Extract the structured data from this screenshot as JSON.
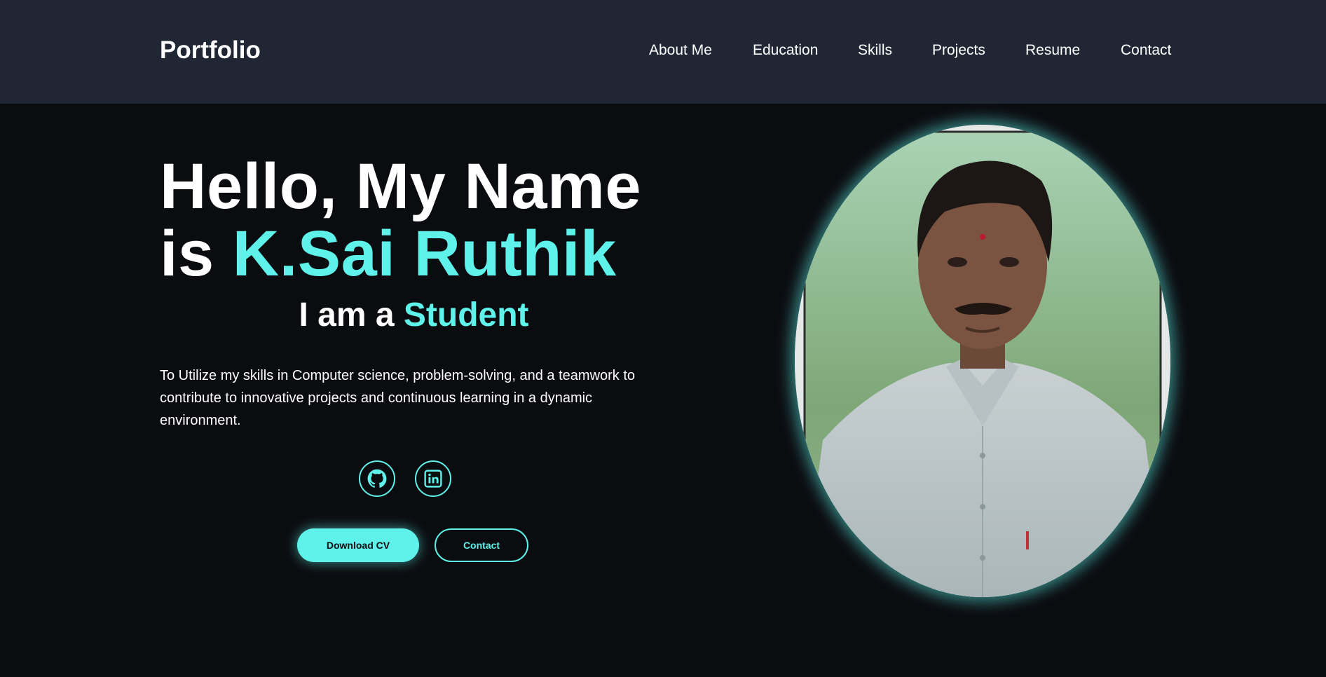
{
  "nav": {
    "brand": "Portfolio",
    "items": [
      {
        "label": "About Me"
      },
      {
        "label": "Education"
      },
      {
        "label": "Skills"
      },
      {
        "label": "Projects"
      },
      {
        "label": "Resume"
      },
      {
        "label": "Contact"
      }
    ]
  },
  "hero": {
    "greeting_line1": "Hello, My Name",
    "greeting_prefix": "is",
    "name": "K.Sai Ruthik",
    "subtitle_prefix": "I am a",
    "role": "Student",
    "summary": "To Utilize my skills in Computer science, problem-solving, and a teamwork to contribute to innovative projects and continuous learning in a dynamic environment.",
    "social": [
      {
        "icon": "github-icon"
      },
      {
        "icon": "linkedin-icon"
      }
    ],
    "buttons": {
      "download_cv": "Download CV",
      "contact": "Contact"
    }
  },
  "colors": {
    "accent": "#5ff2ea",
    "background": "#0b0c10",
    "navbar": "#202634",
    "text": "#ffffff"
  }
}
